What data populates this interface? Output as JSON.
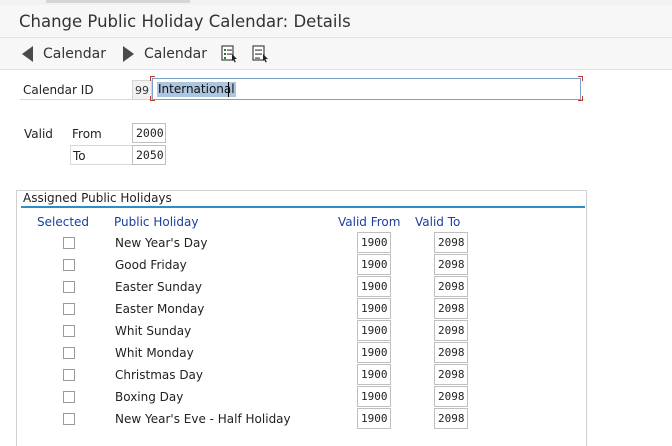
{
  "window": {
    "title": "Change Public Holiday Calendar: Details"
  },
  "toolbar": {
    "prev_label": "Calendar",
    "next_label": "Calendar"
  },
  "header": {
    "calendar_id_label": "Calendar ID",
    "calendar_id_value": "99",
    "calendar_name": "International",
    "valid_label": "Valid",
    "from_label": "From",
    "from_value": "2000",
    "to_label": "To",
    "to_value": "2050"
  },
  "assigned": {
    "title": "Assigned Public Holidays",
    "columns": {
      "selected": "Selected",
      "public_holiday": "Public Holiday",
      "valid_from": "Valid From",
      "valid_to": "Valid To"
    },
    "rows": [
      {
        "name": "New Year's Day",
        "from": "1900",
        "to": "2098",
        "selected": false
      },
      {
        "name": "Good Friday",
        "from": "1900",
        "to": "2098",
        "selected": false
      },
      {
        "name": "Easter Sunday",
        "from": "1900",
        "to": "2098",
        "selected": false
      },
      {
        "name": "Easter Monday",
        "from": "1900",
        "to": "2098",
        "selected": false
      },
      {
        "name": "Whit Sunday",
        "from": "1900",
        "to": "2098",
        "selected": false
      },
      {
        "name": "Whit Monday",
        "from": "1900",
        "to": "2098",
        "selected": false
      },
      {
        "name": "Christmas Day",
        "from": "1900",
        "to": "2098",
        "selected": false
      },
      {
        "name": "Boxing Day",
        "from": "1900",
        "to": "2098",
        "selected": false
      },
      {
        "name": "New Year's Eve - Half Holiday",
        "from": "1900",
        "to": "2098",
        "selected": false
      }
    ]
  },
  "colors": {
    "accent": "#2b8ec4",
    "column_header": "#1a3fa0",
    "selection": "#adc6e0"
  },
  "icons": {
    "prev": "triangle-left-icon",
    "next": "triangle-right-icon",
    "tool1": "list-select-icon",
    "tool2": "list-deselect-icon"
  }
}
